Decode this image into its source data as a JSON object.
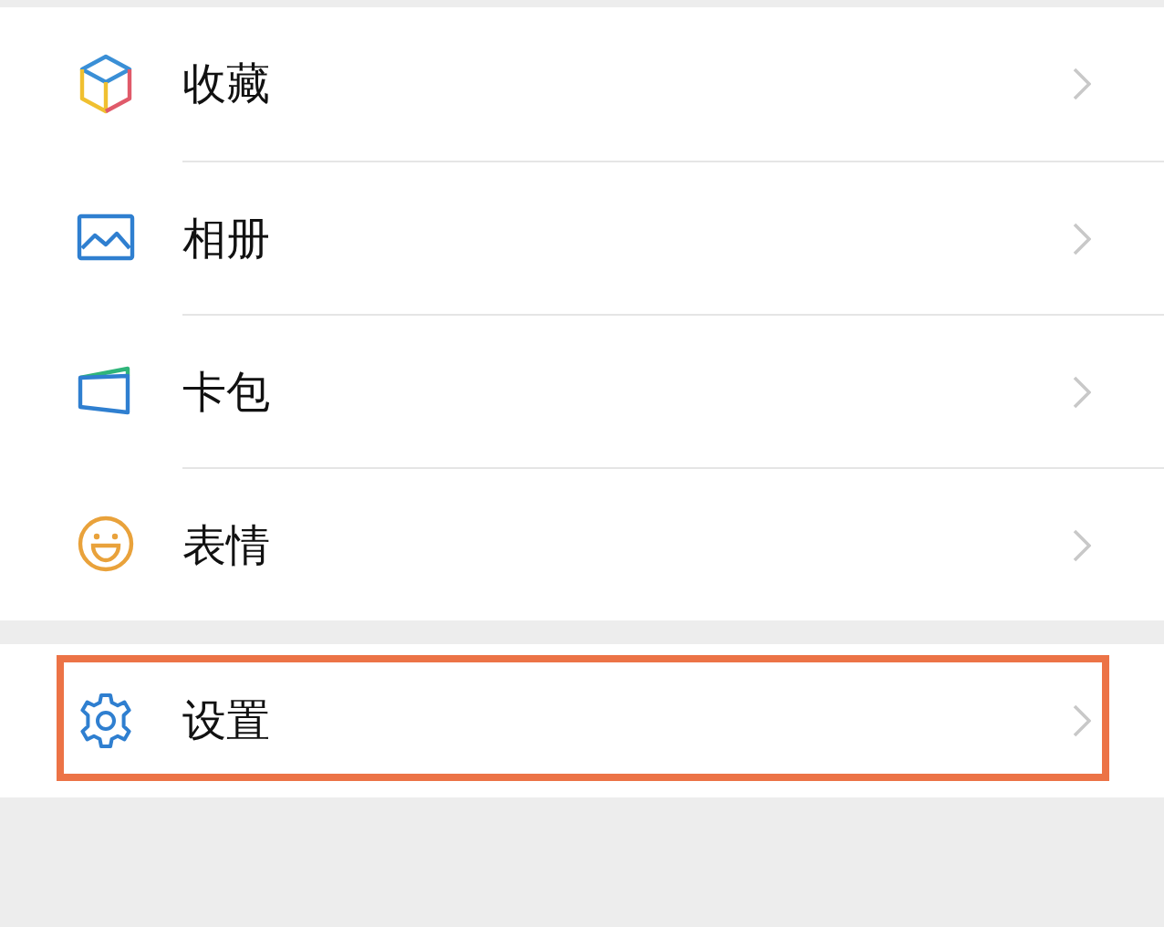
{
  "sections": [
    {
      "items": [
        {
          "kind": "cube",
          "label": "收藏",
          "highlighted": false
        },
        {
          "kind": "landscape",
          "label": "相册",
          "highlighted": false
        },
        {
          "kind": "card",
          "label": "卡包",
          "highlighted": false
        },
        {
          "kind": "smile",
          "label": "表情",
          "highlighted": false
        }
      ]
    },
    {
      "items": [
        {
          "kind": "gear",
          "label": "设置",
          "highlighted": true
        }
      ]
    }
  ]
}
